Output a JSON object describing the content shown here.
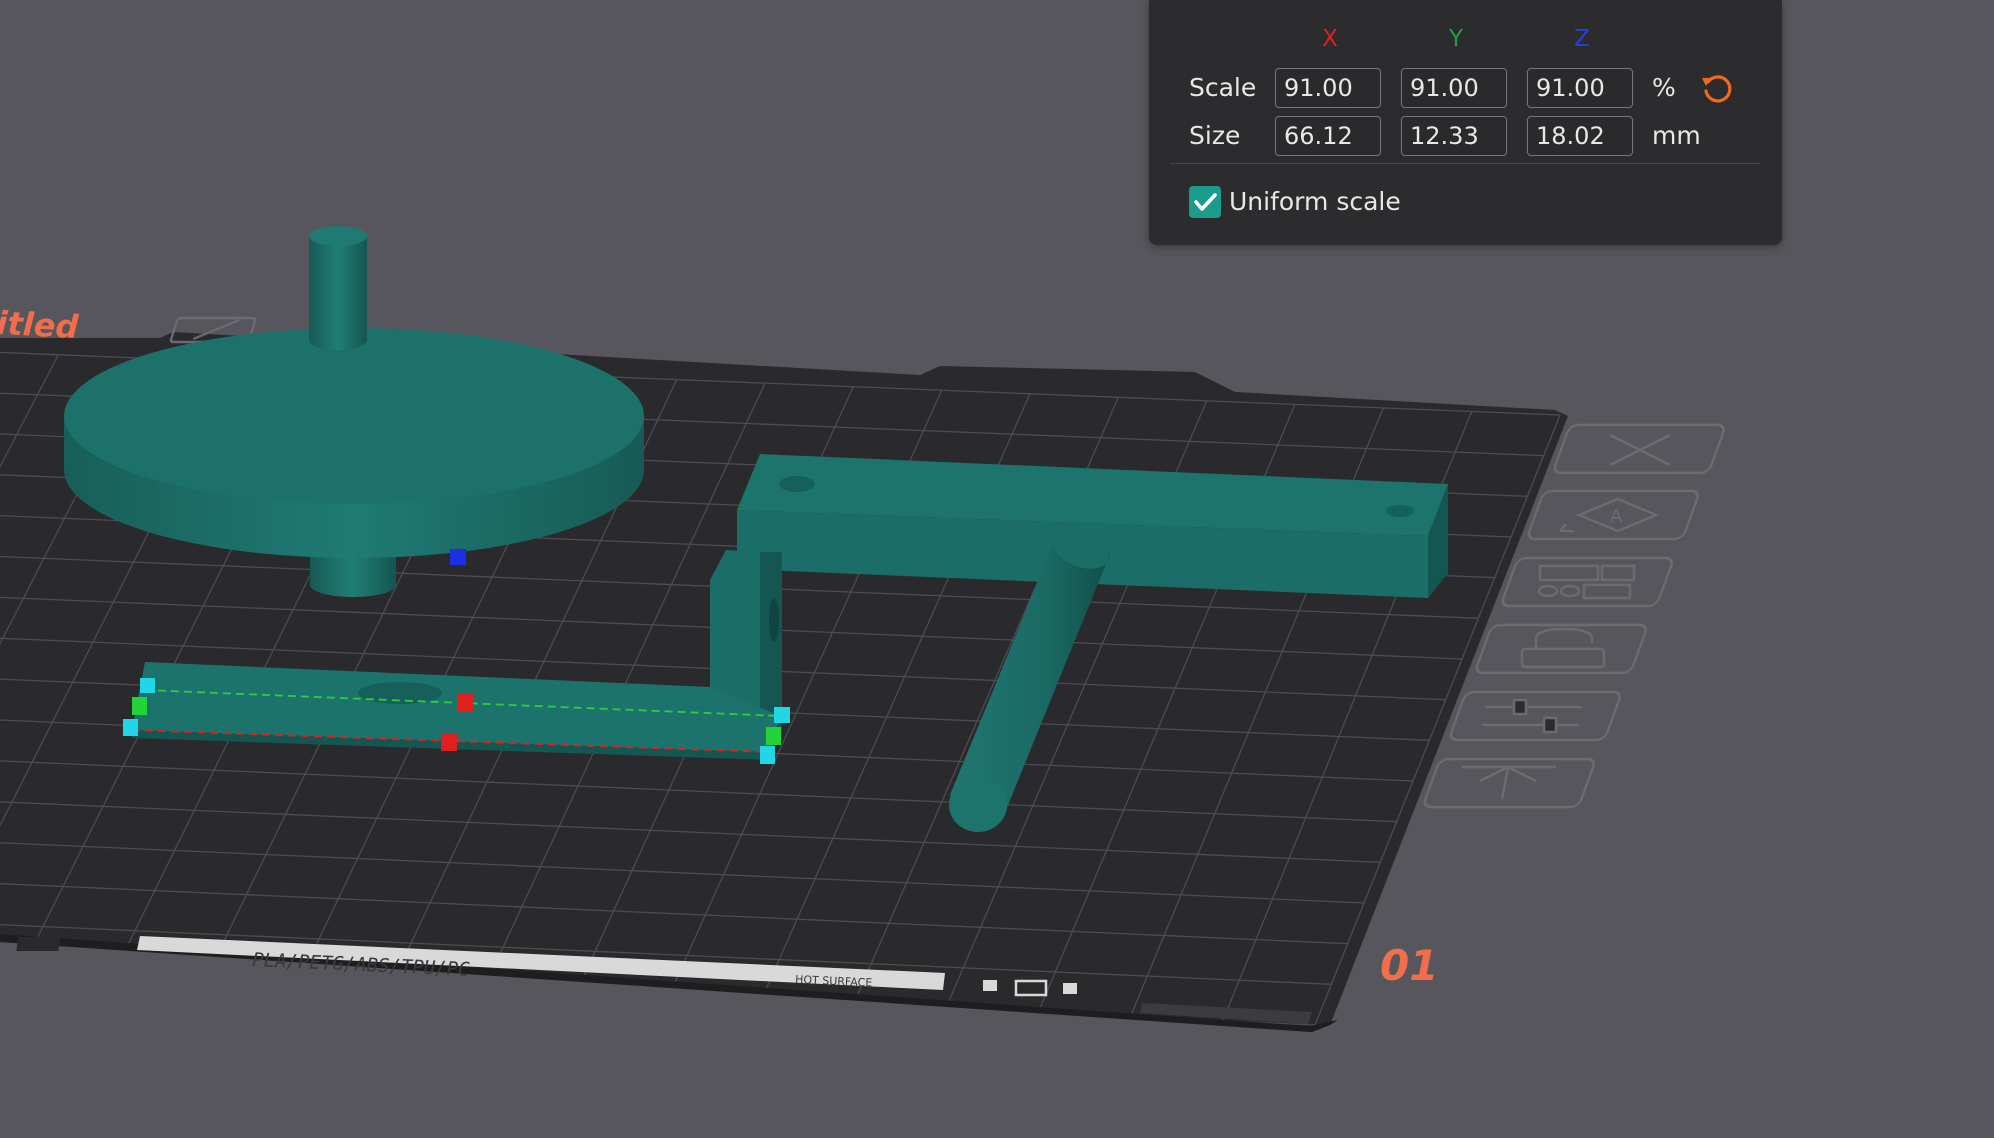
{
  "plate": {
    "name_fragment": "itled",
    "plate_number": "01",
    "strip_text": "PLA/PETG/ABS/TPU/PC",
    "hot_surface_label": "HOT SURFACE"
  },
  "plate_toolbar": {
    "items": [
      {
        "name": "remove-plate",
        "icon": "close-icon"
      },
      {
        "name": "auto-orient",
        "icon": "auto-orient-icon"
      },
      {
        "name": "arrange",
        "icon": "arrange-icon"
      },
      {
        "name": "lock-plate",
        "icon": "lock-icon"
      },
      {
        "name": "plate-settings",
        "icon": "sliders-icon"
      },
      {
        "name": "move-to-plate",
        "icon": "move-up-icon"
      }
    ]
  },
  "scale_panel": {
    "axes": {
      "x": "X",
      "y": "Y",
      "z": "Z"
    },
    "scale_label": "Scale",
    "size_label": "Size",
    "scale_values": {
      "x": "91.00",
      "y": "91.00",
      "z": "91.00"
    },
    "size_values": {
      "x": "66.12",
      "y": "12.33",
      "z": "18.02"
    },
    "scale_unit": "%",
    "size_unit": "mm",
    "uniform_scale_label": "Uniform scale",
    "uniform_scale_checked": true
  },
  "colors": {
    "background": "#56565c",
    "plate": "#2a2a2d",
    "grid": "#4a4a50",
    "model": "#1b6f69",
    "accent": "#1a9c8c",
    "plate_label": "#f26d4b",
    "axis_x": "#e0201f",
    "axis_y": "#1fa43a",
    "axis_z": "#2a3ee0"
  }
}
